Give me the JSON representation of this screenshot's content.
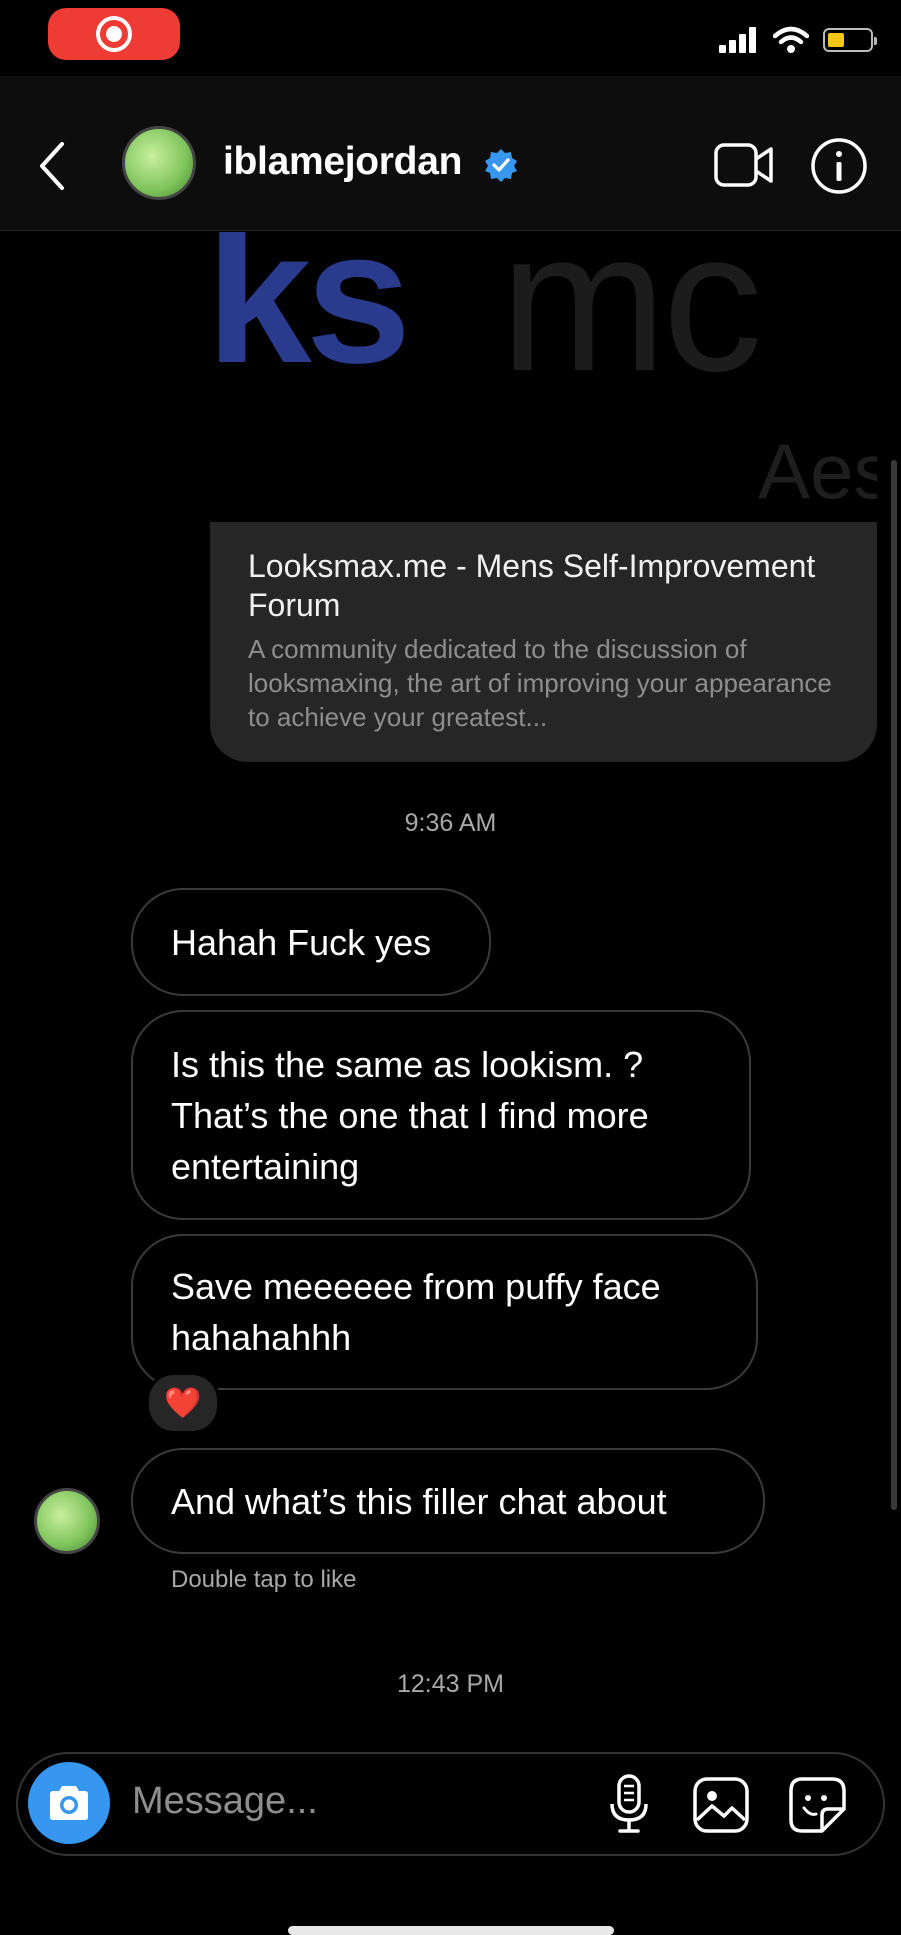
{
  "header": {
    "username": "iblamejordan",
    "back_icon": "chevron-left-icon",
    "verified_icon": "verified-badge-icon",
    "video_icon": "video-call-icon",
    "info_icon": "info-icon"
  },
  "status_bar": {
    "recording_icon": "screen-record-icon",
    "signal_icon": "cellular-signal-icon",
    "wifi_icon": "wifi-icon",
    "battery_icon": "battery-icon",
    "battery_color": "#f5c518"
  },
  "link_preview": {
    "image_text_blue": "ks",
    "image_text_gray": "mc",
    "image_text_small": "Aes",
    "title": "Looksmax.me - Mens Self-Improvement Forum",
    "description": "A community dedicated to the discussion of looksmaxing, the art of improving your appearance to achieve your greatest..."
  },
  "timestamps": [
    "9:36 AM",
    "12:43 PM"
  ],
  "messages": [
    {
      "text": "Hahah Fuck yes"
    },
    {
      "text": "Is this the same as lookism. ? That’s the one that I find more entertaining"
    },
    {
      "text": "Save meeeeee from puffy face hahahahhh",
      "reaction": "❤️"
    },
    {
      "text": "And what’s this filler chat about"
    }
  ],
  "hint": "Double tap to like",
  "composer": {
    "placeholder": "Message...",
    "camera_icon": "camera-icon",
    "mic_icon": "microphone-icon",
    "gallery_icon": "gallery-icon",
    "sticker_icon": "sticker-icon"
  },
  "colors": {
    "accent": "#3797f0",
    "recording": "#ee3b34",
    "bubble_border": "#3a3a3a"
  }
}
